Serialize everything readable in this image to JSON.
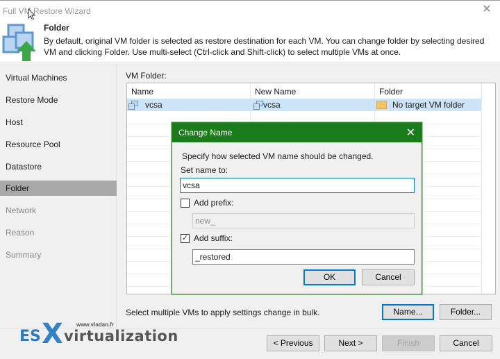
{
  "window": {
    "title": "Full VM Restore Wizard",
    "close_icon": "close-icon"
  },
  "header": {
    "title": "Folder",
    "description": "By default, original VM folder is selected as restore destination for each VM. You can change folder by selecting desired VM and clicking Folder. Use multi-select (Ctrl-click and Shift-click) to select multiple VMs at once.",
    "icon": "vm-restore-icon"
  },
  "sidebar": {
    "items": [
      {
        "label": "Virtual Machines",
        "state": "done"
      },
      {
        "label": "Restore Mode",
        "state": "done"
      },
      {
        "label": "Host",
        "state": "done"
      },
      {
        "label": "Resource Pool",
        "state": "done"
      },
      {
        "label": "Datastore",
        "state": "done"
      },
      {
        "label": "Folder",
        "state": "active"
      },
      {
        "label": "Network",
        "state": "disabled"
      },
      {
        "label": "Reason",
        "state": "disabled"
      },
      {
        "label": "Summary",
        "state": "disabled"
      }
    ]
  },
  "main": {
    "vm_folder_label": "VM Folder:",
    "columns": [
      "Name",
      "New Name",
      "Folder"
    ],
    "rows": [
      {
        "name": "vcsa",
        "new_name": "vcsa",
        "folder": "No target VM folder",
        "selected": true
      }
    ],
    "bulk_hint": "Select multiple VMs to apply settings change in bulk.",
    "name_button": "Name...",
    "folder_button": "Folder..."
  },
  "footer": {
    "previous": "< Previous",
    "next": "Next >",
    "finish": "Finish",
    "cancel": "Cancel"
  },
  "logo": {
    "es": "ES",
    "x": "X",
    "virtualization": "virtualization",
    "url": "www.vladan.fr"
  },
  "dialog": {
    "title": "Change Name",
    "instruction": "Specify how selected VM name should be changed.",
    "set_name_label": "Set name to:",
    "set_name_value": "vcsa",
    "add_prefix_label": "Add prefix:",
    "add_prefix_checked": false,
    "prefix_value": "new_",
    "add_suffix_label": "Add suffix:",
    "add_suffix_checked": true,
    "suffix_value": "_restored",
    "ok": "OK",
    "cancel": "Cancel"
  },
  "colors": {
    "dialog_title_bg": "#1a7c1a",
    "selected_row": "#cce4f7",
    "focus_border": "#0078d7",
    "active_step": "#a8a8a8"
  }
}
